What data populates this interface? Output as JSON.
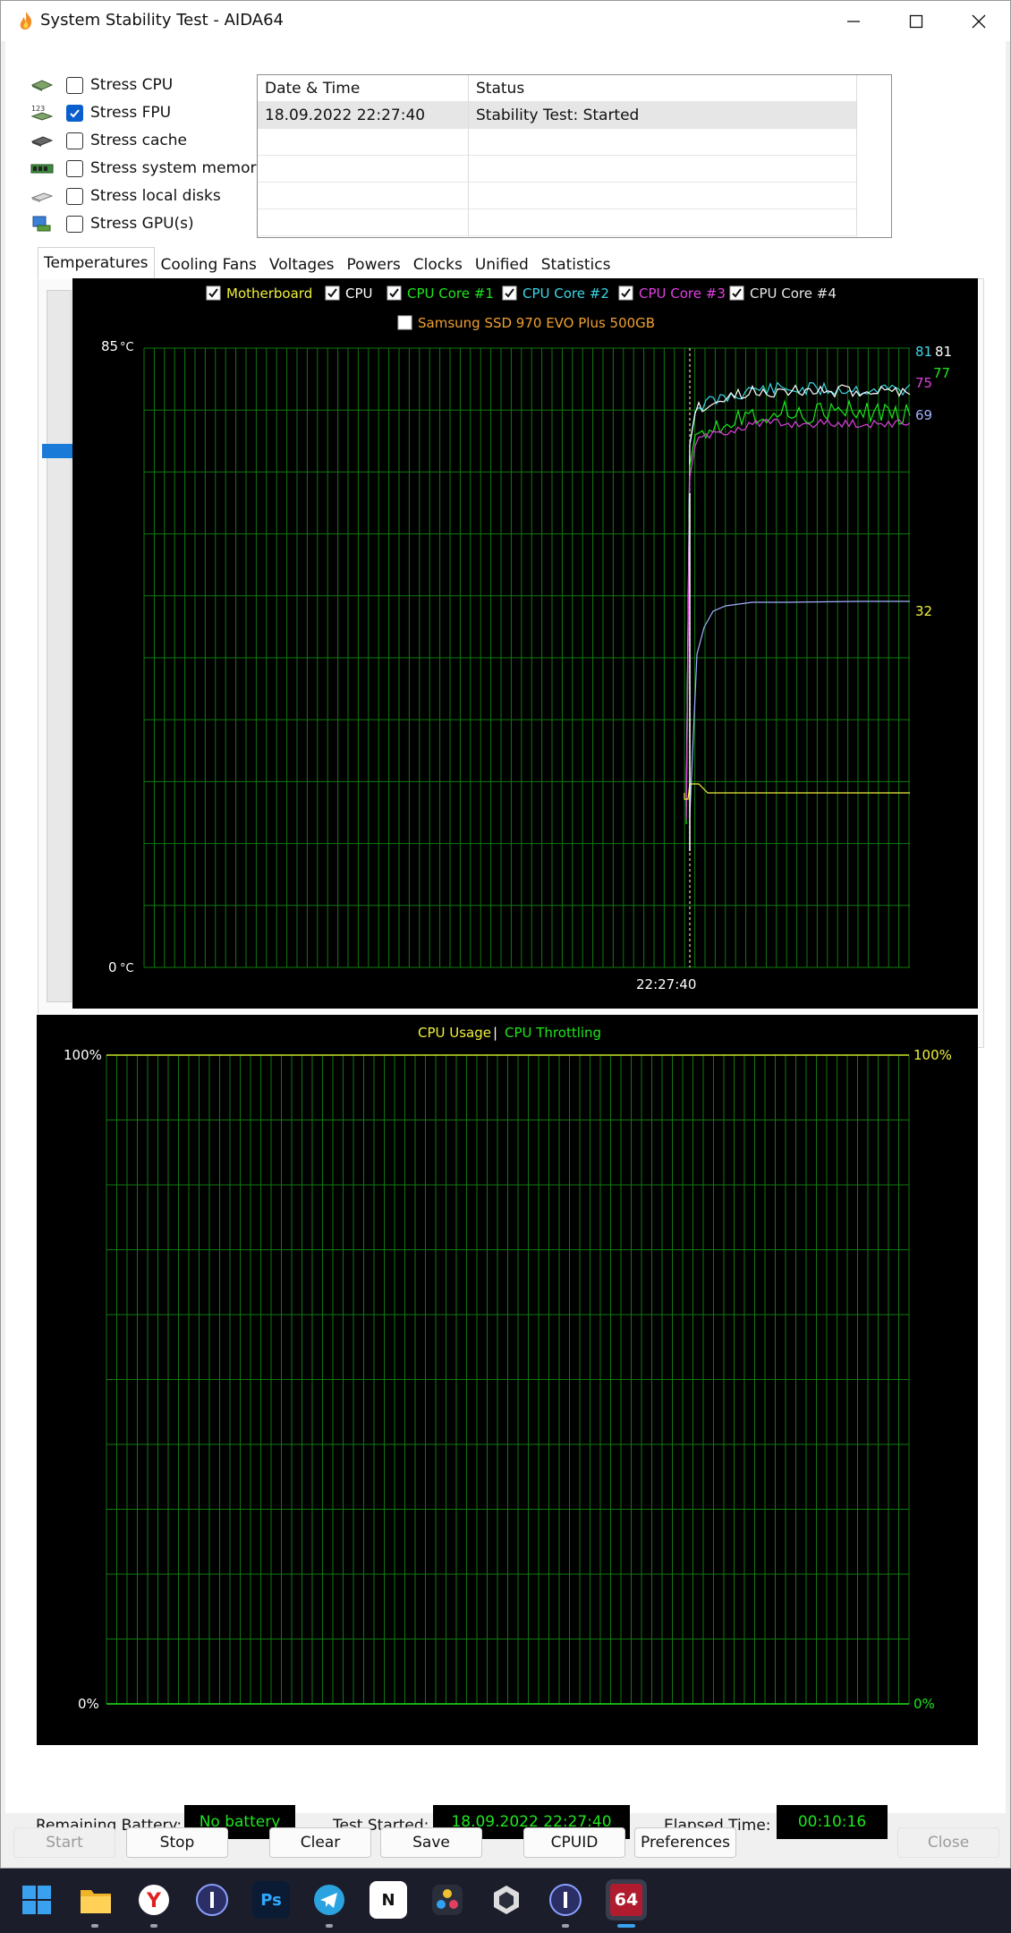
{
  "window": {
    "title": "System Stability Test - AIDA64"
  },
  "stress": [
    {
      "label": "Stress CPU",
      "checked": false,
      "icon": "cpu-chip-icon"
    },
    {
      "label": "Stress FPU",
      "checked": true,
      "icon": "fpu-123-icon"
    },
    {
      "label": "Stress cache",
      "checked": false,
      "icon": "cache-chip-icon"
    },
    {
      "label": "Stress system memory",
      "checked": false,
      "icon": "memory-module-icon"
    },
    {
      "label": "Stress local disks",
      "checked": false,
      "icon": "disk-drive-icon"
    },
    {
      "label": "Stress GPU(s)",
      "checked": false,
      "icon": "gpu-monitor-icon"
    }
  ],
  "log": {
    "headers": [
      "Date & Time",
      "Status"
    ],
    "rows": [
      [
        "18.09.2022 22:27:40",
        "Stability Test: Started"
      ]
    ]
  },
  "tabs": [
    "Temperatures",
    "Cooling Fans",
    "Voltages",
    "Powers",
    "Clocks",
    "Unified",
    "Statistics"
  ],
  "temperature_chart": {
    "legend": [
      {
        "label": "Motherboard",
        "checked": true,
        "color": "#f0f03c"
      },
      {
        "label": "CPU",
        "checked": true,
        "color": "#ffffff"
      },
      {
        "label": "CPU Core #1",
        "checked": true,
        "color": "#1ee61e"
      },
      {
        "label": "CPU Core #2",
        "checked": true,
        "color": "#3cd6e6"
      },
      {
        "label": "CPU Core #3",
        "checked": true,
        "color": "#e040e0"
      },
      {
        "label": "CPU Core #4",
        "checked": true,
        "color": "#e6e6e6"
      },
      {
        "label": "Samsung SSD 970 EVO Plus 500GB",
        "checked": false,
        "color": "#f0a030"
      }
    ],
    "y_max_label": "85",
    "y_min_label": "0",
    "unit": "°C",
    "time_label": "22:27:40",
    "end_values": [
      {
        "value": "81",
        "color": "#3cd6e6"
      },
      {
        "value": "81",
        "color": "#ffffff"
      },
      {
        "value": "77",
        "color": "#1ee61e"
      },
      {
        "value": "75",
        "color": "#e040e0"
      },
      {
        "value": "69",
        "color": "#a0b0ff"
      },
      {
        "value": "32",
        "color": "#f0f03c"
      }
    ]
  },
  "usage_chart": {
    "legend": [
      {
        "label": "CPU Usage",
        "color": "#f0f03c"
      },
      {
        "label": "CPU Throttling",
        "color": "#1ee61e"
      }
    ],
    "separator": "|",
    "left_top": "100%",
    "left_bottom": "0%",
    "right_top": "100%",
    "right_bottom": "0%"
  },
  "info": {
    "battery_label": "Remaining Battery:",
    "battery_value": "No battery",
    "started_label": "Test Started:",
    "started_value": "18.09.2022 22:27:40",
    "elapsed_label": "Elapsed Time:",
    "elapsed_value": "00:10:16"
  },
  "buttons": {
    "start": "Start",
    "stop": "Stop",
    "clear": "Clear",
    "save": "Save",
    "cpuid": "CPUID",
    "preferences": "Preferences",
    "close": "Close"
  },
  "taskbar": [
    {
      "name": "windows-start-icon",
      "color": "#1b1d2a"
    },
    {
      "name": "file-explorer-icon",
      "color": "#f0b429"
    },
    {
      "name": "yandex-browser-icon",
      "color": "#ffffff"
    },
    {
      "name": "1password-icon",
      "color": "#2b2f66"
    },
    {
      "name": "photoshop-icon",
      "color": "#0a1b33",
      "text": "Ps"
    },
    {
      "name": "telegram-icon",
      "color": "#2aa3e0"
    },
    {
      "name": "notion-icon",
      "color": "#ffffff",
      "text": "N"
    },
    {
      "name": "davinci-resolve-icon",
      "color": "#2a2e3a"
    },
    {
      "name": "unity-icon",
      "color": "#2a2e3a"
    },
    {
      "name": "1password-icon-2",
      "color": "#2b2f66"
    },
    {
      "name": "aida64-icon",
      "color": "#b01c2e",
      "text": "64"
    }
  ]
}
